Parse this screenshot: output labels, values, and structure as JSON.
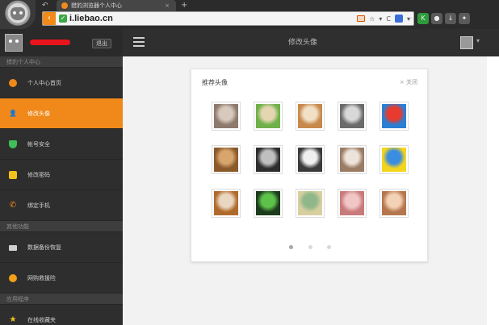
{
  "browser": {
    "tab_title": "猎豹浏览器个人中心",
    "tab_close": "×",
    "tab_new": "+",
    "tab_back": "↶",
    "url": "i.liebao.cn",
    "url_star": "☆",
    "url_refresh": "C",
    "url_dropdown": "▾",
    "search_icon_glyph": "⌕",
    "toolbar_ext": "K"
  },
  "header": {
    "logout_label": "退出",
    "page_title": "修改头像",
    "caret": "▾"
  },
  "sidebar": {
    "sections": [
      "猎豹个人中心",
      "其他功能",
      "应用程序"
    ],
    "items": [
      {
        "label": "个人中心首页",
        "icon": "home-icon",
        "color": "#f0891a"
      },
      {
        "label": "修改头像",
        "icon": "avatar-icon",
        "color": "#ffffff",
        "active": true
      },
      {
        "label": "帐号安全",
        "icon": "shield-icon",
        "color": "#3fbf5a"
      },
      {
        "label": "修改密码",
        "icon": "lock-icon",
        "color": "#f0c21a"
      },
      {
        "label": "绑定手机",
        "icon": "phone-icon",
        "color": "#f0891a"
      },
      {
        "label": "数据备份恢复",
        "icon": "backup-icon",
        "color": "#cfcfcf"
      },
      {
        "label": "网购救援险",
        "icon": "shopping-icon",
        "color": "#f0a01a"
      },
      {
        "label": "在线收藏夹",
        "icon": "star-icon",
        "color": "#f0c21a"
      }
    ]
  },
  "card": {
    "title": "推荐头像",
    "close_label": "× 关闭",
    "avatars": [
      {
        "name": "hippo",
        "colors": [
          "#8d7a6c",
          "#d7c9bd"
        ]
      },
      {
        "name": "frog",
        "colors": [
          "#6fb04a",
          "#e4d6b0"
        ]
      },
      {
        "name": "girl-hat",
        "colors": [
          "#c7884b",
          "#f1e0c5"
        ]
      },
      {
        "name": "feathers",
        "colors": [
          "#6b6b6b",
          "#d8d8d8"
        ]
      },
      {
        "name": "doraemon",
        "colors": [
          "#2a7fd4",
          "#e63b2e"
        ]
      },
      {
        "name": "dog",
        "colors": [
          "#8a5a2b",
          "#d8a56c"
        ]
      },
      {
        "name": "man-portrait",
        "colors": [
          "#2d2d2d",
          "#bfbfbf"
        ]
      },
      {
        "name": "figure-bw",
        "colors": [
          "#3a3a3a",
          "#efefef"
        ]
      },
      {
        "name": "girl-sketch",
        "colors": [
          "#9a7b63",
          "#ece3da"
        ]
      },
      {
        "name": "spongebob",
        "colors": [
          "#f4d51e",
          "#3a8de0"
        ]
      },
      {
        "name": "tiger",
        "colors": [
          "#b06a2c",
          "#e9d7c0"
        ]
      },
      {
        "name": "green-monster",
        "colors": [
          "#1d3b1d",
          "#5cc24a"
        ]
      },
      {
        "name": "bottles",
        "colors": [
          "#d7cfa0",
          "#8fb78a"
        ]
      },
      {
        "name": "flower",
        "colors": [
          "#c97a7a",
          "#f1c6c6"
        ]
      },
      {
        "name": "girl-photo",
        "colors": [
          "#b5764e",
          "#f4d2b6"
        ]
      }
    ],
    "pages": 3,
    "current_page": 1
  }
}
